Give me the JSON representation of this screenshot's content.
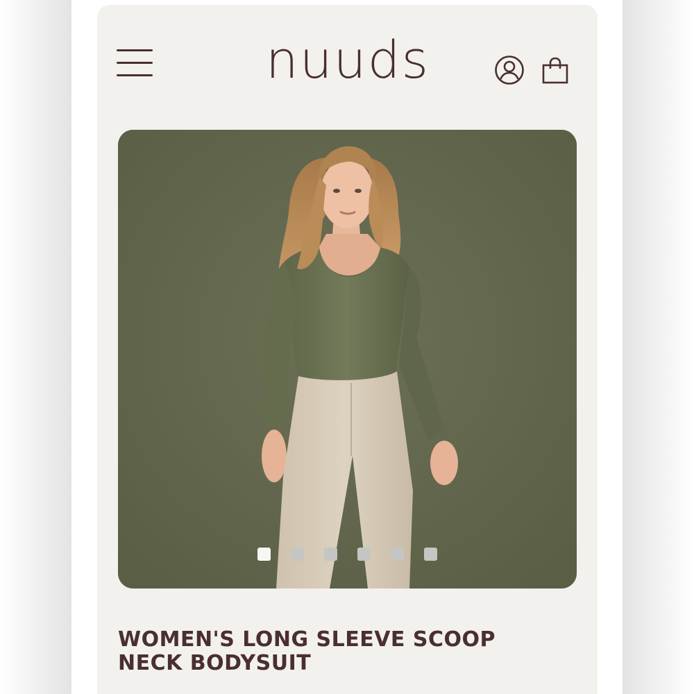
{
  "header": {
    "logo_text": "nuuds",
    "menu_icon": "hamburger-menu-icon",
    "account_icon": "user-account-icon",
    "bag_icon": "shopping-bag-icon"
  },
  "gallery": {
    "image_count": 6,
    "active_index": 0,
    "background_color": "#676b50"
  },
  "product": {
    "title": "WOMEN'S LONG SLEEVE SCOOP NECK BODYSUIT"
  },
  "colors": {
    "brand": "#4a2e31",
    "screen_background": "#f2f1ee",
    "dot_active": "#f6f6f4",
    "dot_inactive": "#c5c6c3"
  }
}
